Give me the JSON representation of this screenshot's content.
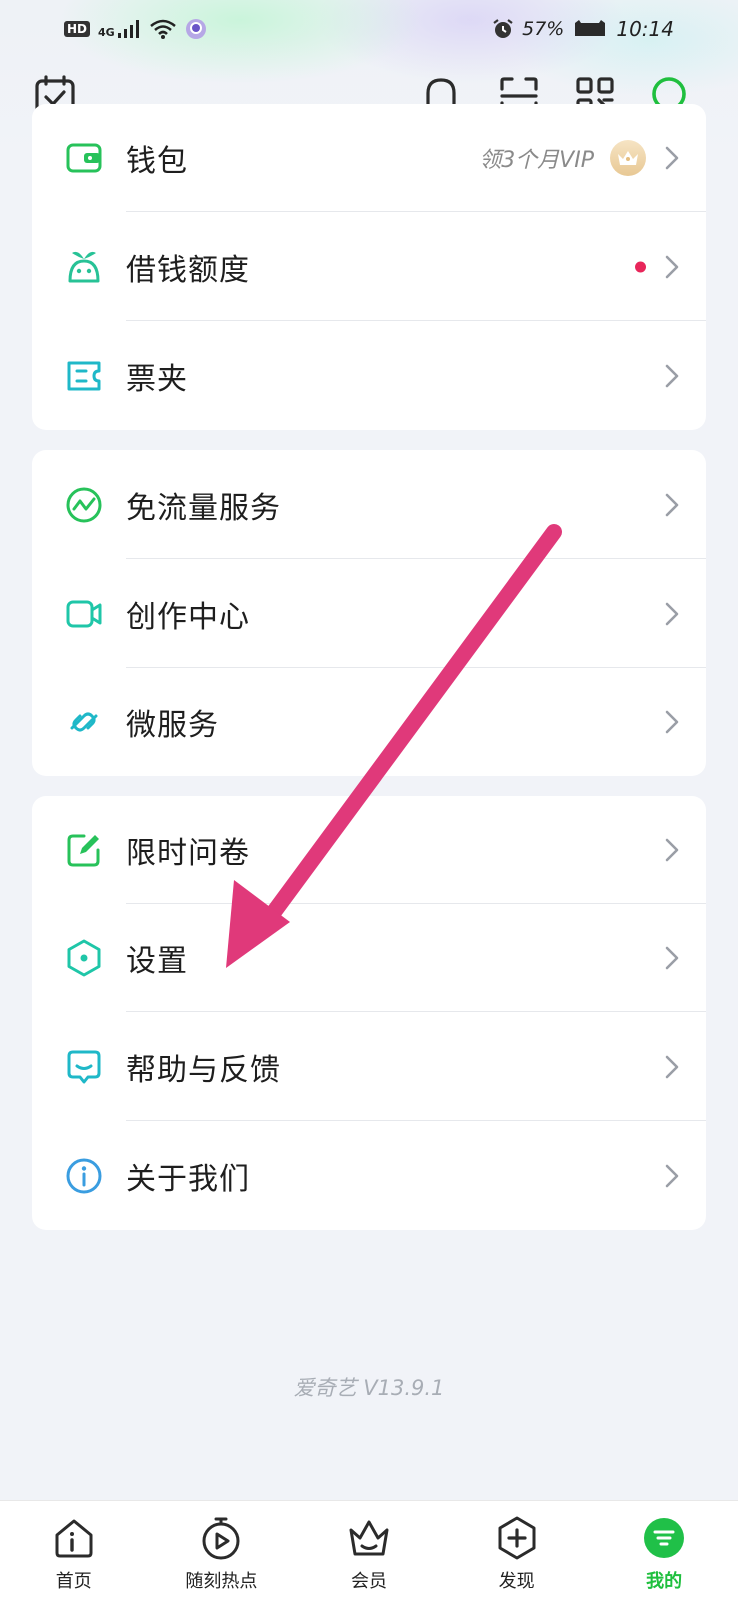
{
  "status_bar": {
    "hd": "HD",
    "network": "4G",
    "battery_pct": "57%",
    "time": "10:14"
  },
  "header": {
    "icons": [
      "calendar-check-icon",
      "bell-icon",
      "scan-icon",
      "qr-code-icon",
      "search-icon"
    ]
  },
  "cards": [
    {
      "items": [
        {
          "label": "钱包",
          "icon": "wallet-icon",
          "extra_text": "领3个月VIP",
          "badge": "crown"
        },
        {
          "label": "借钱额度",
          "icon": "sprout-icon",
          "dot": true
        },
        {
          "label": "票夹",
          "icon": "ticket-icon"
        }
      ]
    },
    {
      "items": [
        {
          "label": "免流量服务",
          "icon": "data-free-icon"
        },
        {
          "label": "创作中心",
          "icon": "video-camera-icon"
        },
        {
          "label": "微服务",
          "icon": "link-icon"
        }
      ]
    },
    {
      "items": [
        {
          "label": "限时问卷",
          "icon": "edit-icon"
        },
        {
          "label": "设置",
          "icon": "settings-hexagon-icon"
        },
        {
          "label": "帮助与反馈",
          "icon": "feedback-icon"
        },
        {
          "label": "关于我们",
          "icon": "info-icon"
        }
      ]
    }
  ],
  "version": "爱奇艺 V13.9.1",
  "bottom_nav": [
    {
      "label": "首页",
      "icon": "home-icon"
    },
    {
      "label": "随刻热点",
      "icon": "play-timer-icon"
    },
    {
      "label": "会员",
      "icon": "vip-basket-icon"
    },
    {
      "label": "发现",
      "icon": "plus-discover-icon"
    },
    {
      "label": "我的",
      "icon": "profile-active-icon",
      "active": true
    }
  ],
  "colors": {
    "accent_green": "#1fbf3e",
    "icon_teal": "#1fc6a8",
    "red_dot": "#e8265a",
    "arrow_pink": "#e0397a"
  }
}
